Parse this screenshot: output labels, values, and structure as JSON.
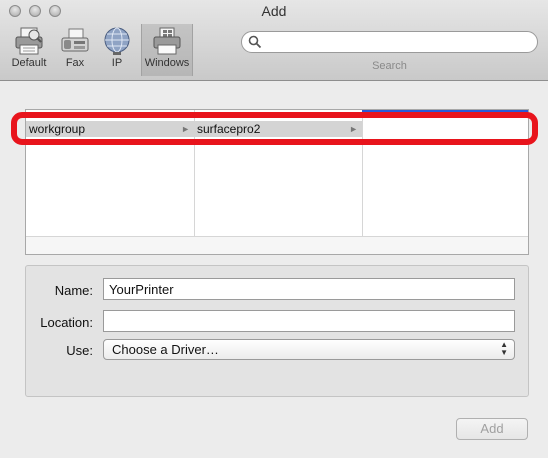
{
  "window": {
    "title": "Add"
  },
  "toolbar": {
    "items": [
      {
        "label": "Default",
        "icon": "printer-icon"
      },
      {
        "label": "Fax",
        "icon": "fax-icon"
      },
      {
        "label": "IP",
        "icon": "globe-icon"
      },
      {
        "label": "Windows",
        "icon": "windows-printer-icon",
        "selected": true
      }
    ],
    "search": {
      "value": "",
      "label": "Search"
    }
  },
  "browser": {
    "columns": [
      {
        "partial_above": "",
        "selected": "workgroup",
        "partial_below": ""
      },
      {
        "partial_above": "",
        "selected": "surfacepro2",
        "partial_below": ""
      },
      {
        "partial_above": "",
        "selected": "",
        "partial_below": ""
      }
    ],
    "selection_color": "#2a5ad6"
  },
  "highlight": {
    "color": "#e8141c"
  },
  "form": {
    "name_label": "Name:",
    "name_value": "YourPrinter",
    "location_label": "Location:",
    "location_value": "",
    "use_label": "Use:",
    "use_value": "Choose a Driver…"
  },
  "buttons": {
    "add_label": "Add"
  }
}
